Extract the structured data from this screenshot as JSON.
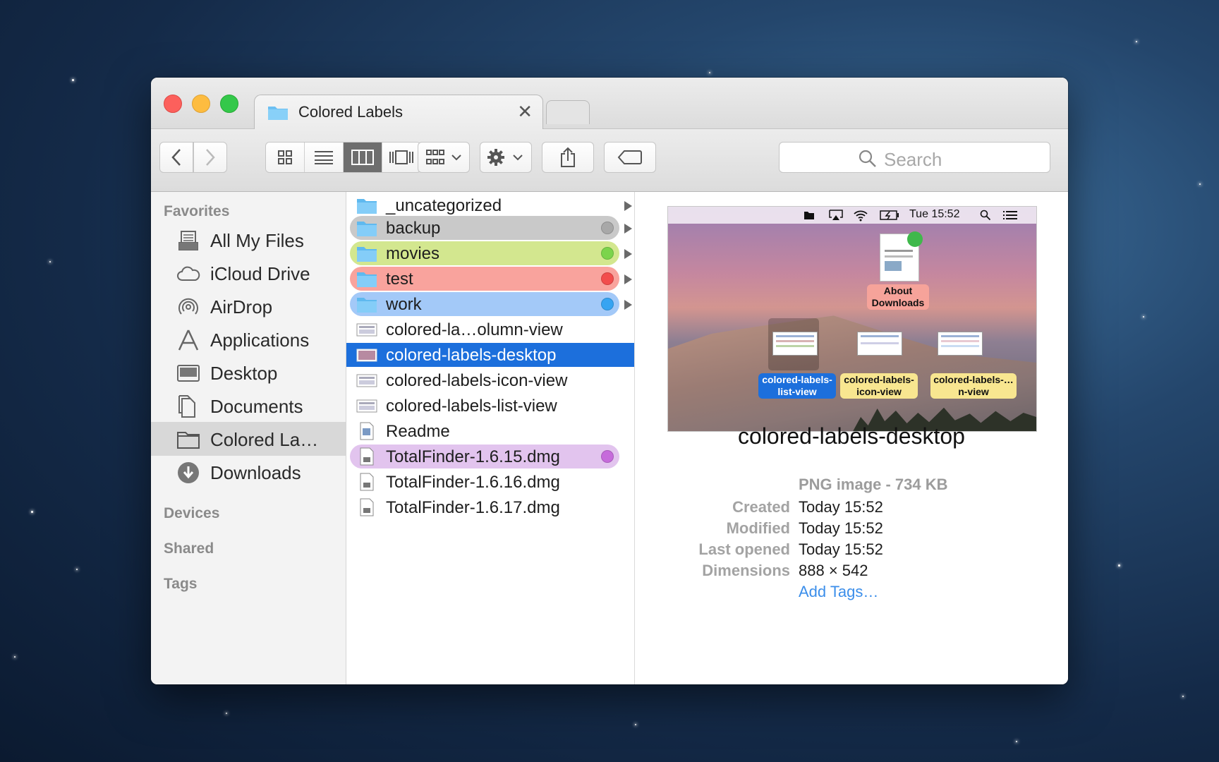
{
  "window": {
    "tab_title": "Colored Labels",
    "close_glyph": "✕"
  },
  "toolbar": {
    "search_placeholder": "Search"
  },
  "sidebar": {
    "favorites_heading": "Favorites",
    "devices_heading": "Devices",
    "shared_heading": "Shared",
    "tags_heading": "Tags",
    "items": [
      {
        "label": "All My Files",
        "icon": "all-files-icon"
      },
      {
        "label": "iCloud Drive",
        "icon": "cloud-icon"
      },
      {
        "label": "AirDrop",
        "icon": "airdrop-icon"
      },
      {
        "label": "Applications",
        "icon": "applications-icon"
      },
      {
        "label": "Desktop",
        "icon": "desktop-icon"
      },
      {
        "label": "Documents",
        "icon": "documents-icon"
      },
      {
        "label": "Colored La…",
        "icon": "folder-icon",
        "selected": true
      },
      {
        "label": "Downloads",
        "icon": "downloads-icon"
      }
    ]
  },
  "files": [
    {
      "label": "_uncategorized",
      "kind": "folder",
      "tag_color": null
    },
    {
      "label": "backup",
      "kind": "folder",
      "tag_color": "#a8a8a8"
    },
    {
      "label": "movies",
      "kind": "folder",
      "tag_color": "#7cd44c"
    },
    {
      "label": "test",
      "kind": "folder",
      "tag_color": "#f24d4d"
    },
    {
      "label": "work",
      "kind": "folder",
      "tag_color": "#36a4f2"
    },
    {
      "label": "colored-la…olumn-view",
      "kind": "image",
      "tag_color": null
    },
    {
      "label": "colored-labels-desktop",
      "kind": "image",
      "tag_color": null,
      "selected": true
    },
    {
      "label": "colored-labels-icon-view",
      "kind": "image",
      "tag_color": null
    },
    {
      "label": "colored-labels-list-view",
      "kind": "image",
      "tag_color": null
    },
    {
      "label": "Readme",
      "kind": "document",
      "tag_color": null
    },
    {
      "label": "TotalFinder-1.6.15.dmg",
      "kind": "disk-image",
      "tag_color": "#c66bdb"
    },
    {
      "label": "TotalFinder-1.6.16.dmg",
      "kind": "disk-image",
      "tag_color": null
    },
    {
      "label": "TotalFinder-1.6.17.dmg",
      "kind": "disk-image",
      "tag_color": null
    }
  ],
  "tag_pill_colors": {
    "backup": "#c9c9c9",
    "movies": "#d3e78f",
    "test": "#f9a39d",
    "work": "#a3c9f8",
    "TotalFinder-1.6.15.dmg": "#e2c4ee"
  },
  "preview": {
    "menubar_time": "Tue 15:52",
    "desktop_items": {
      "about_downloads": "About Downloads",
      "list_view": "colored-labels-list-view",
      "icon_view": "colored-labels-icon-view",
      "column_view": "colored-labels-…n-view"
    },
    "name": "colored-labels-desktop",
    "kind": "PNG image - 734 KB",
    "meta": [
      {
        "key": "Created",
        "value": "Today 15:52"
      },
      {
        "key": "Modified",
        "value": "Today 15:52"
      },
      {
        "key": "Last opened",
        "value": "Today 15:52"
      },
      {
        "key": "Dimensions",
        "value": "888 × 542"
      }
    ],
    "add_tags": "Add Tags…"
  },
  "colors": {
    "selection": "#1c6fdc",
    "close": "#fc605c",
    "minimize": "#fdbc40",
    "zoom": "#34c84a",
    "link": "#3b8eea"
  }
}
